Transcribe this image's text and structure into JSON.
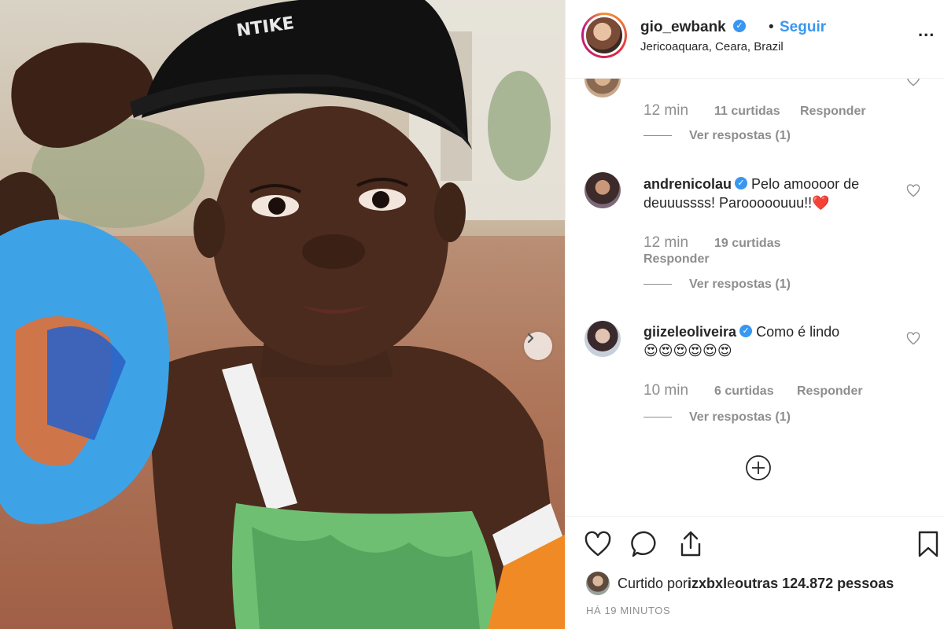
{
  "post": {
    "username": "gio_ewbank",
    "dot": "•",
    "follow_label": "Seguir",
    "location": "Jericoaquara, Ceara, Brazil",
    "more_label": "..."
  },
  "comments": [
    {
      "likes": "11 curtidas",
      "time": "12 min",
      "reply_label": "Responder",
      "view_replies": "Ver respostas (1)"
    },
    {
      "user": "andrenicolau",
      "text": "Pelo amoooor de deuuussss! Parooooouuu!!❤️",
      "time": "12 min",
      "likes": "19 curtidas",
      "reply_label": "Responder",
      "view_replies": "Ver respostas (1)"
    },
    {
      "user": "giizeleoliveira",
      "text": "Como é lindo",
      "emojis": "😍😍😍😍😍😍",
      "time": "10 min",
      "likes": "6 curtidas",
      "reply_label": "Responder",
      "view_replies": "Ver respostas (1)"
    }
  ],
  "footer": {
    "liked_prefix": "Curtido por ",
    "liked_user": "izxbxl",
    "liked_mid": " e ",
    "liked_others": "outras 124.872 pessoas",
    "timestamp": "HÁ 19 MINUTOS"
  },
  "icons": {
    "verified": "verified-badge-icon",
    "next": "chevron-right-icon",
    "like": "heart-icon",
    "comment": "speech-bubble-icon",
    "share": "share-icon",
    "save": "bookmark-icon",
    "load_more": "plus-circle-icon"
  },
  "colors": {
    "accent": "#3897f0",
    "text": "#262626",
    "muted": "#8e8e8e",
    "heart": "#ed4956"
  }
}
